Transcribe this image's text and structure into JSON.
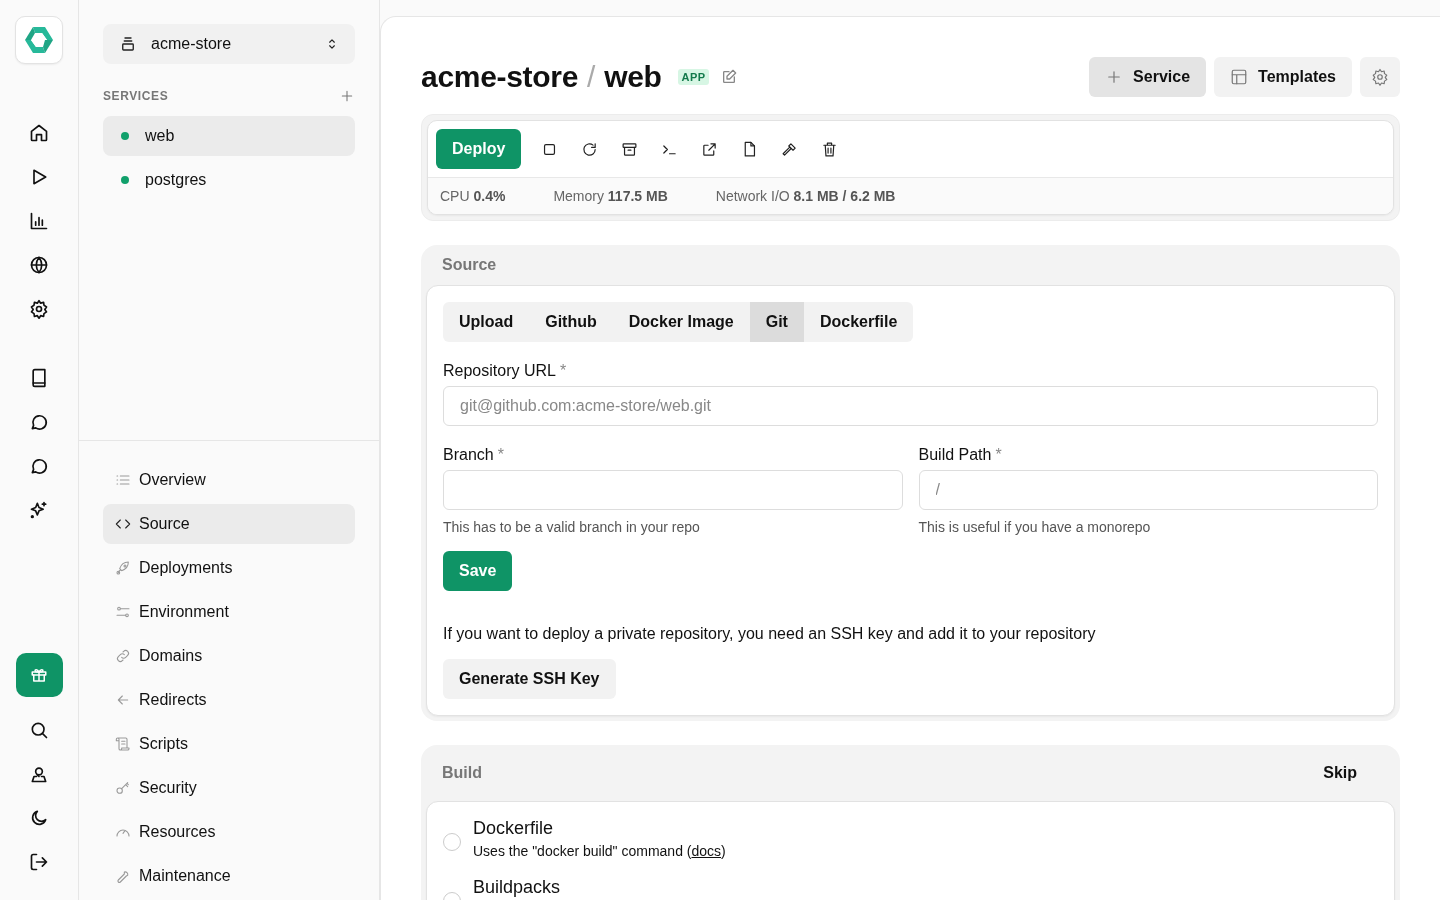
{
  "project": {
    "name": "acme-store"
  },
  "services": {
    "heading": "SERVICES",
    "items": [
      {
        "name": "web",
        "color": "#10a06b",
        "selected": true
      },
      {
        "name": "postgres",
        "color": "#10a06b",
        "selected": false
      }
    ]
  },
  "nav": [
    {
      "label": "Overview",
      "selected": false
    },
    {
      "label": "Source",
      "selected": true
    },
    {
      "label": "Deployments",
      "selected": false
    },
    {
      "label": "Environment",
      "selected": false
    },
    {
      "label": "Domains",
      "selected": false
    },
    {
      "label": "Redirects",
      "selected": false
    },
    {
      "label": "Scripts",
      "selected": false
    },
    {
      "label": "Security",
      "selected": false
    },
    {
      "label": "Resources",
      "selected": false
    },
    {
      "label": "Maintenance",
      "selected": false
    }
  ],
  "header": {
    "project": "acme-store",
    "separator": "/",
    "service": "web",
    "badge": "APP",
    "buttons": [
      "Service",
      "Templates"
    ]
  },
  "toolbar": {
    "deploy": "Deploy",
    "stats": [
      {
        "label": "CPU",
        "value": "0.4%"
      },
      {
        "label": "Memory",
        "value": "117.5 MB"
      },
      {
        "label": "Network I/O",
        "value": "8.1 MB / 6.2 MB"
      }
    ]
  },
  "source": {
    "title": "Source",
    "tabs": [
      {
        "label": "Upload",
        "selected": false
      },
      {
        "label": "Github",
        "selected": false
      },
      {
        "label": "Docker Image",
        "selected": false
      },
      {
        "label": "Git",
        "selected": true
      },
      {
        "label": "Dockerfile",
        "selected": false
      }
    ],
    "fields": [
      {
        "label": "Repository URL",
        "required_mark": "*",
        "placeholder": "git@github.com:acme-store/web.git"
      },
      {
        "label": "Branch",
        "required_mark": "*",
        "hint": "This has to be a valid branch in your repo"
      },
      {
        "label": "Build Path",
        "required_mark": "*",
        "placeholder": "/",
        "hint": "This is useful if you have a monorepo"
      }
    ],
    "save": "Save",
    "ssh_note": "If you want to deploy a private repository, you need an SSH key and add it to your repository",
    "ssh_button": "Generate SSH Key"
  },
  "build": {
    "title": "Build",
    "skip": "Skip",
    "options": [
      {
        "title": "Dockerfile",
        "description_before": "Uses the \"docker build\" command (",
        "link": "docs",
        "description_after": ")",
        "checked": false
      },
      {
        "title": "Buildpacks",
        "checked": false
      }
    ]
  }
}
